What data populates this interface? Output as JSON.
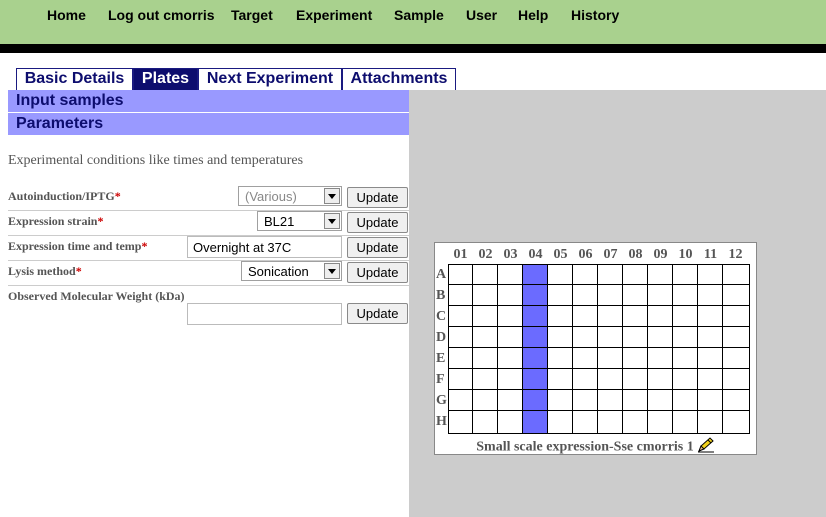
{
  "nav": {
    "home": "Home",
    "logout": "Log out cmorris",
    "target": "Target",
    "experiment": "Experiment",
    "sample": "Sample",
    "user": "User",
    "help": "Help",
    "history": "History"
  },
  "tabs": {
    "basic_details": "Basic Details",
    "plates": "Plates",
    "next_experiment": "Next Experiment",
    "attachments": "Attachments",
    "active": "Plates"
  },
  "sections": {
    "input_samples": "Input samples",
    "parameters": "Parameters"
  },
  "intro": "Experimental conditions like times and temperatures",
  "params": [
    {
      "label": "Autoinduction/IPTG",
      "required": "*",
      "value": "(Various)",
      "control": "select",
      "disabled": true,
      "button": "Update"
    },
    {
      "label": "Expression strain",
      "required": "*",
      "value": "BL21",
      "control": "select",
      "disabled": false,
      "button": "Update"
    },
    {
      "label": "Expression time and temp",
      "required": "*",
      "value": "Overnight at 37C",
      "control": "text",
      "button": "Update"
    },
    {
      "label": "Lysis method",
      "required": "*",
      "value": "Sonication",
      "control": "select",
      "disabled": false,
      "button": "Update"
    },
    {
      "label": "Observed Molecular Weight (kDa)",
      "required": "",
      "value": "",
      "control": "text",
      "button": "Update"
    }
  ],
  "plate": {
    "columns": [
      "01",
      "02",
      "03",
      "04",
      "05",
      "06",
      "07",
      "08",
      "09",
      "10",
      "11",
      "12"
    ],
    "rows": [
      "A",
      "B",
      "C",
      "D",
      "E",
      "F",
      "G",
      "H"
    ],
    "selected_column": "04",
    "caption": "Small scale expression-Sse cmorris 1",
    "selected_color": "#6b6bff",
    "edit_icon": "pencil-icon"
  },
  "colors": {
    "topbar": "#a9d18e",
    "tab_active": "#0d0d6e",
    "section_header": "#9999ff",
    "required": "#cc0000"
  }
}
